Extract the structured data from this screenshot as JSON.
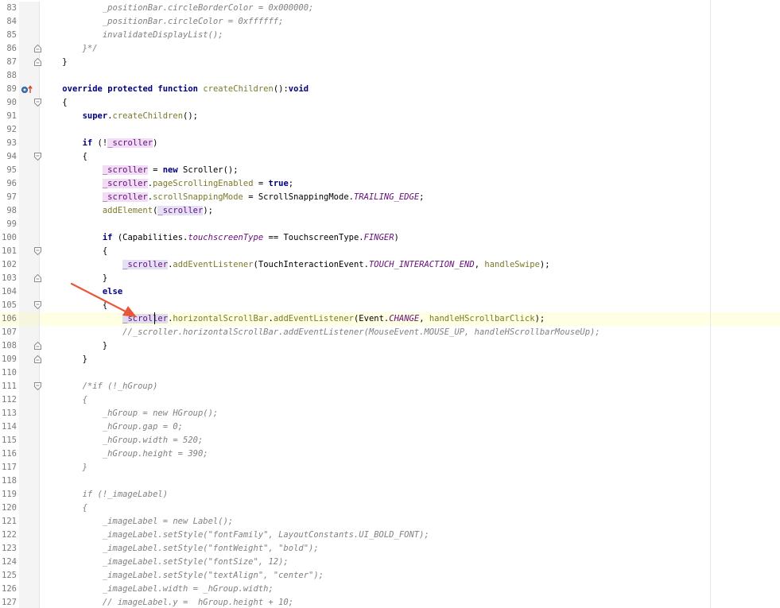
{
  "editor": {
    "current_line": "106",
    "lines": [
      {
        "num": "83",
        "fold": "none",
        "tokens": [
          {
            "t": "            "
          },
          {
            "t": "_positionBar.circleBorderColor = 0x000000;",
            "c": "cm"
          }
        ]
      },
      {
        "num": "84",
        "fold": "none",
        "tokens": [
          {
            "t": "            "
          },
          {
            "t": "_positionBar.circleColor = 0xffffff;",
            "c": "cm"
          }
        ]
      },
      {
        "num": "85",
        "fold": "none",
        "tokens": [
          {
            "t": "            "
          },
          {
            "t": "invalidateDisplayList();",
            "c": "cm"
          }
        ]
      },
      {
        "num": "86",
        "fold": "end",
        "tokens": [
          {
            "t": "        "
          },
          {
            "t": "}*/",
            "c": "cm"
          }
        ]
      },
      {
        "num": "87",
        "fold": "end",
        "tokens": [
          {
            "t": "    }"
          }
        ]
      },
      {
        "num": "88",
        "fold": "none",
        "tokens": []
      },
      {
        "num": "89",
        "fold": "none",
        "marker": "override",
        "tokens": [
          {
            "t": "    "
          },
          {
            "t": "override protected function",
            "c": "kw"
          },
          {
            "t": " "
          },
          {
            "t": "createChildren",
            "c": "mth"
          },
          {
            "t": "():"
          },
          {
            "t": "void",
            "c": "kw"
          }
        ]
      },
      {
        "num": "90",
        "fold": "start",
        "tokens": [
          {
            "t": "    {"
          }
        ]
      },
      {
        "num": "91",
        "fold": "none",
        "tokens": [
          {
            "t": "        "
          },
          {
            "t": "super",
            "c": "kw"
          },
          {
            "t": "."
          },
          {
            "t": "createChildren",
            "c": "mth"
          },
          {
            "t": "();"
          }
        ]
      },
      {
        "num": "92",
        "fold": "none",
        "tokens": []
      },
      {
        "num": "93",
        "fold": "none",
        "tokens": [
          {
            "t": "        "
          },
          {
            "t": "if",
            "c": "kw"
          },
          {
            "t": " (!"
          },
          {
            "t": "_scroller",
            "c": "fld hl"
          },
          {
            "t": ")"
          }
        ]
      },
      {
        "num": "94",
        "fold": "start",
        "tokens": [
          {
            "t": "        {"
          }
        ]
      },
      {
        "num": "95",
        "fold": "none",
        "tokens": [
          {
            "t": "            "
          },
          {
            "t": "_scroller",
            "c": "fld hl"
          },
          {
            "t": " = "
          },
          {
            "t": "new",
            "c": "kw"
          },
          {
            "t": " Scroller();"
          }
        ]
      },
      {
        "num": "96",
        "fold": "none",
        "tokens": [
          {
            "t": "            "
          },
          {
            "t": "_scroller",
            "c": "fld hl"
          },
          {
            "t": "."
          },
          {
            "t": "pageScrollingEnabled",
            "c": "mth"
          },
          {
            "t": " = "
          },
          {
            "t": "true",
            "c": "kw"
          },
          {
            "t": ";"
          }
        ]
      },
      {
        "num": "97",
        "fold": "none",
        "tokens": [
          {
            "t": "            "
          },
          {
            "t": "_scroller",
            "c": "fld hl"
          },
          {
            "t": "."
          },
          {
            "t": "scrollSnappingMode",
            "c": "mth"
          },
          {
            "t": " = ScrollSnappingMode."
          },
          {
            "t": "TRAILING_EDGE",
            "c": "cst"
          },
          {
            "t": ";"
          }
        ]
      },
      {
        "num": "98",
        "fold": "none",
        "tokens": [
          {
            "t": "            "
          },
          {
            "t": "addElement",
            "c": "mth"
          },
          {
            "t": "("
          },
          {
            "t": "_scroller",
            "c": "fld hl2"
          },
          {
            "t": ");"
          }
        ]
      },
      {
        "num": "99",
        "fold": "none",
        "tokens": []
      },
      {
        "num": "100",
        "fold": "none",
        "tokens": [
          {
            "t": "            "
          },
          {
            "t": "if",
            "c": "kw"
          },
          {
            "t": " (Capabilities."
          },
          {
            "t": "touchscreenType",
            "c": "cst"
          },
          {
            "t": " == TouchscreenType."
          },
          {
            "t": "FINGER",
            "c": "cst"
          },
          {
            "t": ")"
          }
        ]
      },
      {
        "num": "101",
        "fold": "start",
        "tokens": [
          {
            "t": "            {"
          }
        ]
      },
      {
        "num": "102",
        "fold": "none",
        "tokens": [
          {
            "t": "                "
          },
          {
            "t": "_scroller",
            "c": "fld hl2"
          },
          {
            "t": "."
          },
          {
            "t": "addEventListener",
            "c": "mth"
          },
          {
            "t": "(TouchInteractionEvent."
          },
          {
            "t": "TOUCH_INTERACTION_END",
            "c": "cst"
          },
          {
            "t": ", "
          },
          {
            "t": "handleSwipe",
            "c": "mth"
          },
          {
            "t": ");"
          }
        ]
      },
      {
        "num": "103",
        "fold": "end",
        "tokens": [
          {
            "t": "            }"
          }
        ]
      },
      {
        "num": "104",
        "fold": "none",
        "tokens": [
          {
            "t": "            "
          },
          {
            "t": "else",
            "c": "kw"
          }
        ]
      },
      {
        "num": "105",
        "fold": "start",
        "tokens": [
          {
            "t": "            {"
          }
        ]
      },
      {
        "num": "106",
        "fold": "none",
        "tokens": [
          {
            "t": "                "
          },
          {
            "t": "_scroller",
            "c": "fld sel"
          },
          {
            "t": "."
          },
          {
            "t": "horizontalScrollBar",
            "c": "mth"
          },
          {
            "t": "."
          },
          {
            "t": "addEventListener",
            "c": "mth"
          },
          {
            "t": "(Event."
          },
          {
            "t": "CHANGE",
            "c": "cst"
          },
          {
            "t": ", "
          },
          {
            "t": "handleHScrollbarClick",
            "c": "mth"
          },
          {
            "t": ");"
          }
        ]
      },
      {
        "num": "107",
        "fold": "none",
        "tokens": [
          {
            "t": "                "
          },
          {
            "t": "//_scroller.horizontalScrollBar.addEventListener(MouseEvent.MOUSE_UP, handleHScrollbarMouseUp);",
            "c": "cm"
          }
        ]
      },
      {
        "num": "108",
        "fold": "end",
        "tokens": [
          {
            "t": "            }"
          }
        ]
      },
      {
        "num": "109",
        "fold": "end",
        "tokens": [
          {
            "t": "        }"
          }
        ]
      },
      {
        "num": "110",
        "fold": "none",
        "tokens": []
      },
      {
        "num": "111",
        "fold": "start",
        "tokens": [
          {
            "t": "        "
          },
          {
            "t": "/*if (!_hGroup)",
            "c": "cm"
          }
        ]
      },
      {
        "num": "112",
        "fold": "none",
        "tokens": [
          {
            "t": "        "
          },
          {
            "t": "{",
            "c": "cm"
          }
        ]
      },
      {
        "num": "113",
        "fold": "none",
        "tokens": [
          {
            "t": "            "
          },
          {
            "t": "_hGroup = new HGroup();",
            "c": "cm"
          }
        ]
      },
      {
        "num": "114",
        "fold": "none",
        "tokens": [
          {
            "t": "            "
          },
          {
            "t": "_hGroup.gap = 0;",
            "c": "cm"
          }
        ]
      },
      {
        "num": "115",
        "fold": "none",
        "tokens": [
          {
            "t": "            "
          },
          {
            "t": "_hGroup.width = 520;",
            "c": "cm"
          }
        ]
      },
      {
        "num": "116",
        "fold": "none",
        "tokens": [
          {
            "t": "            "
          },
          {
            "t": "_hGroup.height = 390;",
            "c": "cm"
          }
        ]
      },
      {
        "num": "117",
        "fold": "none",
        "tokens": [
          {
            "t": "        "
          },
          {
            "t": "}",
            "c": "cm"
          }
        ]
      },
      {
        "num": "118",
        "fold": "none",
        "tokens": []
      },
      {
        "num": "119",
        "fold": "none",
        "tokens": [
          {
            "t": "        "
          },
          {
            "t": "if (!_imageLabel)",
            "c": "cm"
          }
        ]
      },
      {
        "num": "120",
        "fold": "none",
        "tokens": [
          {
            "t": "        "
          },
          {
            "t": "{",
            "c": "cm"
          }
        ]
      },
      {
        "num": "121",
        "fold": "none",
        "tokens": [
          {
            "t": "            "
          },
          {
            "t": "_imageLabel = new Label();",
            "c": "cm"
          }
        ]
      },
      {
        "num": "122",
        "fold": "none",
        "tokens": [
          {
            "t": "            "
          },
          {
            "t": "_imageLabel.setStyle(\"fontFamily\", LayoutConstants.UI_BOLD_FONT);",
            "c": "cm"
          }
        ]
      },
      {
        "num": "123",
        "fold": "none",
        "tokens": [
          {
            "t": "            "
          },
          {
            "t": "_imageLabel.setStyle(\"fontWeight\", \"bold\");",
            "c": "cm"
          }
        ]
      },
      {
        "num": "124",
        "fold": "none",
        "tokens": [
          {
            "t": "            "
          },
          {
            "t": "_imageLabel.setStyle(\"fontSize\", 12);",
            "c": "cm"
          }
        ]
      },
      {
        "num": "125",
        "fold": "none",
        "tokens": [
          {
            "t": "            "
          },
          {
            "t": "_imageLabel.setStyle(\"textAlign\", \"center\");",
            "c": "cm"
          }
        ]
      },
      {
        "num": "126",
        "fold": "none",
        "tokens": [
          {
            "t": "            "
          },
          {
            "t": "_imageLabel.width = _hGroup.width;",
            "c": "cm"
          }
        ]
      },
      {
        "num": "127",
        "fold": "none",
        "tokens": [
          {
            "t": "            "
          },
          {
            "t": "// imageLabel.y =  hGroup.height + 10;",
            "c": "cm"
          }
        ]
      }
    ]
  }
}
